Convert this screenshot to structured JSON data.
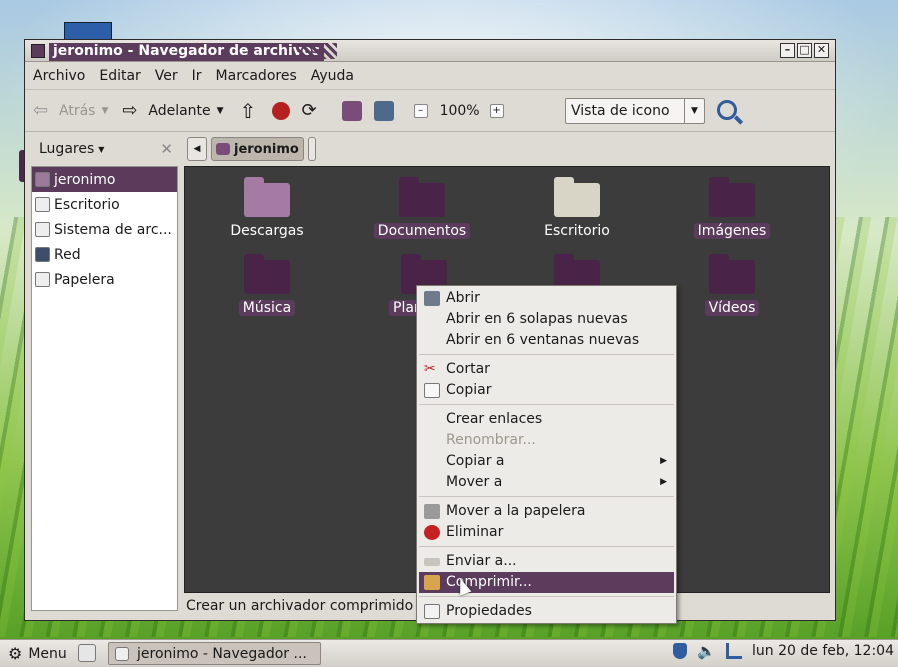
{
  "window": {
    "title": "jeronimo - Navegador de archivos",
    "controls": [
      "minimize",
      "maximize",
      "close"
    ]
  },
  "menubar": [
    "Archivo",
    "Editar",
    "Ver",
    "Ir",
    "Marcadores",
    "Ayuda"
  ],
  "toolbar": {
    "back_label": "Atrás",
    "forward_label": "Adelante",
    "zoom": "100%",
    "view_mode": "Vista de icono"
  },
  "sidebar": {
    "header": "Lugares",
    "items": [
      {
        "label": "jeronimo",
        "icon": "home-icon",
        "selected": true
      },
      {
        "label": "Escritorio",
        "icon": "desktop-icon"
      },
      {
        "label": "Sistema de arc...",
        "icon": "drive-icon"
      },
      {
        "label": "Red",
        "icon": "network-icon"
      },
      {
        "label": "Papelera",
        "icon": "trash-icon"
      }
    ]
  },
  "pathbar": {
    "current": "jeronimo"
  },
  "files": [
    {
      "name": "Descargas",
      "style": "light"
    },
    {
      "name": "Documentos",
      "style": "purple",
      "selected": true
    },
    {
      "name": "Escritorio",
      "style": "grey"
    },
    {
      "name": "Imágenes",
      "style": "purple",
      "selected": true
    },
    {
      "name": "Música",
      "style": "purple",
      "selected": true
    },
    {
      "name": "Plan",
      "style": "purple",
      "selected": true
    },
    {
      "name": "",
      "style": "purple"
    },
    {
      "name": "Vídeos",
      "style": "purple",
      "selected": true
    }
  ],
  "statusbar": "Crear un archivador comprimido c",
  "context_menu": {
    "items": [
      {
        "label": "Abrir",
        "icon": "open-icon"
      },
      {
        "label": "Abrir en 6 solapas nuevas"
      },
      {
        "label": "Abrir en 6 ventanas nuevas"
      },
      {
        "separator": true
      },
      {
        "label": "Cortar",
        "icon": "scissors-icon"
      },
      {
        "label": "Copiar",
        "icon": "copy-icon"
      },
      {
        "separator": true
      },
      {
        "label": "Crear enlaces"
      },
      {
        "label": "Renombrar...",
        "disabled": true
      },
      {
        "label": "Copiar a",
        "submenu": true
      },
      {
        "label": "Mover a",
        "submenu": true
      },
      {
        "separator": true
      },
      {
        "label": "Mover a la papelera",
        "icon": "trash-icon"
      },
      {
        "label": "Eliminar",
        "icon": "delete-icon"
      },
      {
        "separator": true
      },
      {
        "label": "Enviar a...",
        "icon": "send-icon"
      },
      {
        "label": "Comprimir...",
        "icon": "archive-icon",
        "highlighted": true
      },
      {
        "separator": true
      },
      {
        "label": "Propiedades",
        "icon": "properties-icon"
      }
    ]
  },
  "taskbar": {
    "menu_label": "Menu",
    "task_label": "jeronimo - Navegador ...",
    "clock": "lun 20 de feb, 12:04"
  },
  "colors": {
    "accent": "#5c3c5c",
    "folder": "#4a2448"
  }
}
